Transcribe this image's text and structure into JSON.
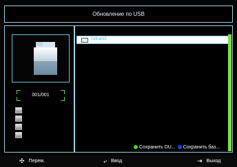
{
  "header": {
    "title": "Обновление по USB"
  },
  "left_panel": {
    "counter": "001/001",
    "preview_icon": "folder-icon",
    "file_type_icons": [
      "music-file-icon",
      "person-file-icon",
      "document-file-icon",
      "photo-file-icon"
    ]
  },
  "file_list": {
    "items": [
      {
        "label": "/sdcard1",
        "icon": "folder-icon",
        "selected": true
      }
    ]
  },
  "legend": {
    "items": [
      {
        "label": "Сохранить DU...",
        "color": "#46d42e"
      },
      {
        "label": "Сохранить баз...",
        "color": "#1e3cff"
      }
    ]
  },
  "bottom_bar": {
    "move": {
      "label": "Перем.",
      "icon": "dpad-icon"
    },
    "enter": {
      "label": "Ввод",
      "icon": "enter-icon"
    },
    "exit": {
      "label": "Выход",
      "icon": "exit-icon"
    }
  },
  "colors": {
    "border": "#9fd0e0",
    "accent": "#4fb6dc",
    "scrollbar": "#7de045"
  }
}
